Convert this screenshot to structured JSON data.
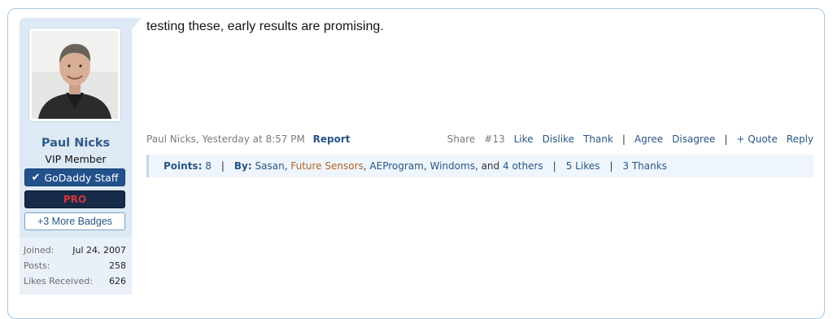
{
  "post": {
    "message": "testing these, early results are promising.",
    "user": {
      "name": "Paul Nicks",
      "title": "VIP Member",
      "avatar_icon": "user-avatar-photo",
      "badges": {
        "staff_check": "✔",
        "staff": "GoDaddy Staff",
        "pro": "PRO",
        "more": "+3 More Badges"
      },
      "stats": [
        {
          "label": "Joined:",
          "value": "Jul 24, 2007"
        },
        {
          "label": "Posts:",
          "value": "258"
        },
        {
          "label": "Likes Received:",
          "value": "626"
        }
      ]
    },
    "meta": {
      "author_date": "Paul Nicks, Yesterday at 8:57 PM",
      "report": "Report",
      "share": "Share",
      "post_number": "#13",
      "like": "Like",
      "dislike": "Dislike",
      "thank": "Thank",
      "sep": "|",
      "agree": "Agree",
      "disagree": "Disagree",
      "quote": "+ Quote",
      "reply": "Reply"
    },
    "reactions": {
      "points_label": "Points:",
      "points_value": "8",
      "by_label": "By:",
      "users": [
        "Sasan",
        "Future Sensors",
        "AEProgram",
        "Windoms"
      ],
      "comma": ",",
      "and_text": ", and",
      "others": "4 others",
      "likes": "5 Likes",
      "thanks": "3 Thanks",
      "sep": "|"
    },
    "colors": {
      "link": "#2a5686",
      "staff_badge": "#22518c",
      "pro_badge_bg": "#172a47",
      "pro_badge_text": "#d3363c",
      "highlight_user": "#b5651d"
    }
  }
}
